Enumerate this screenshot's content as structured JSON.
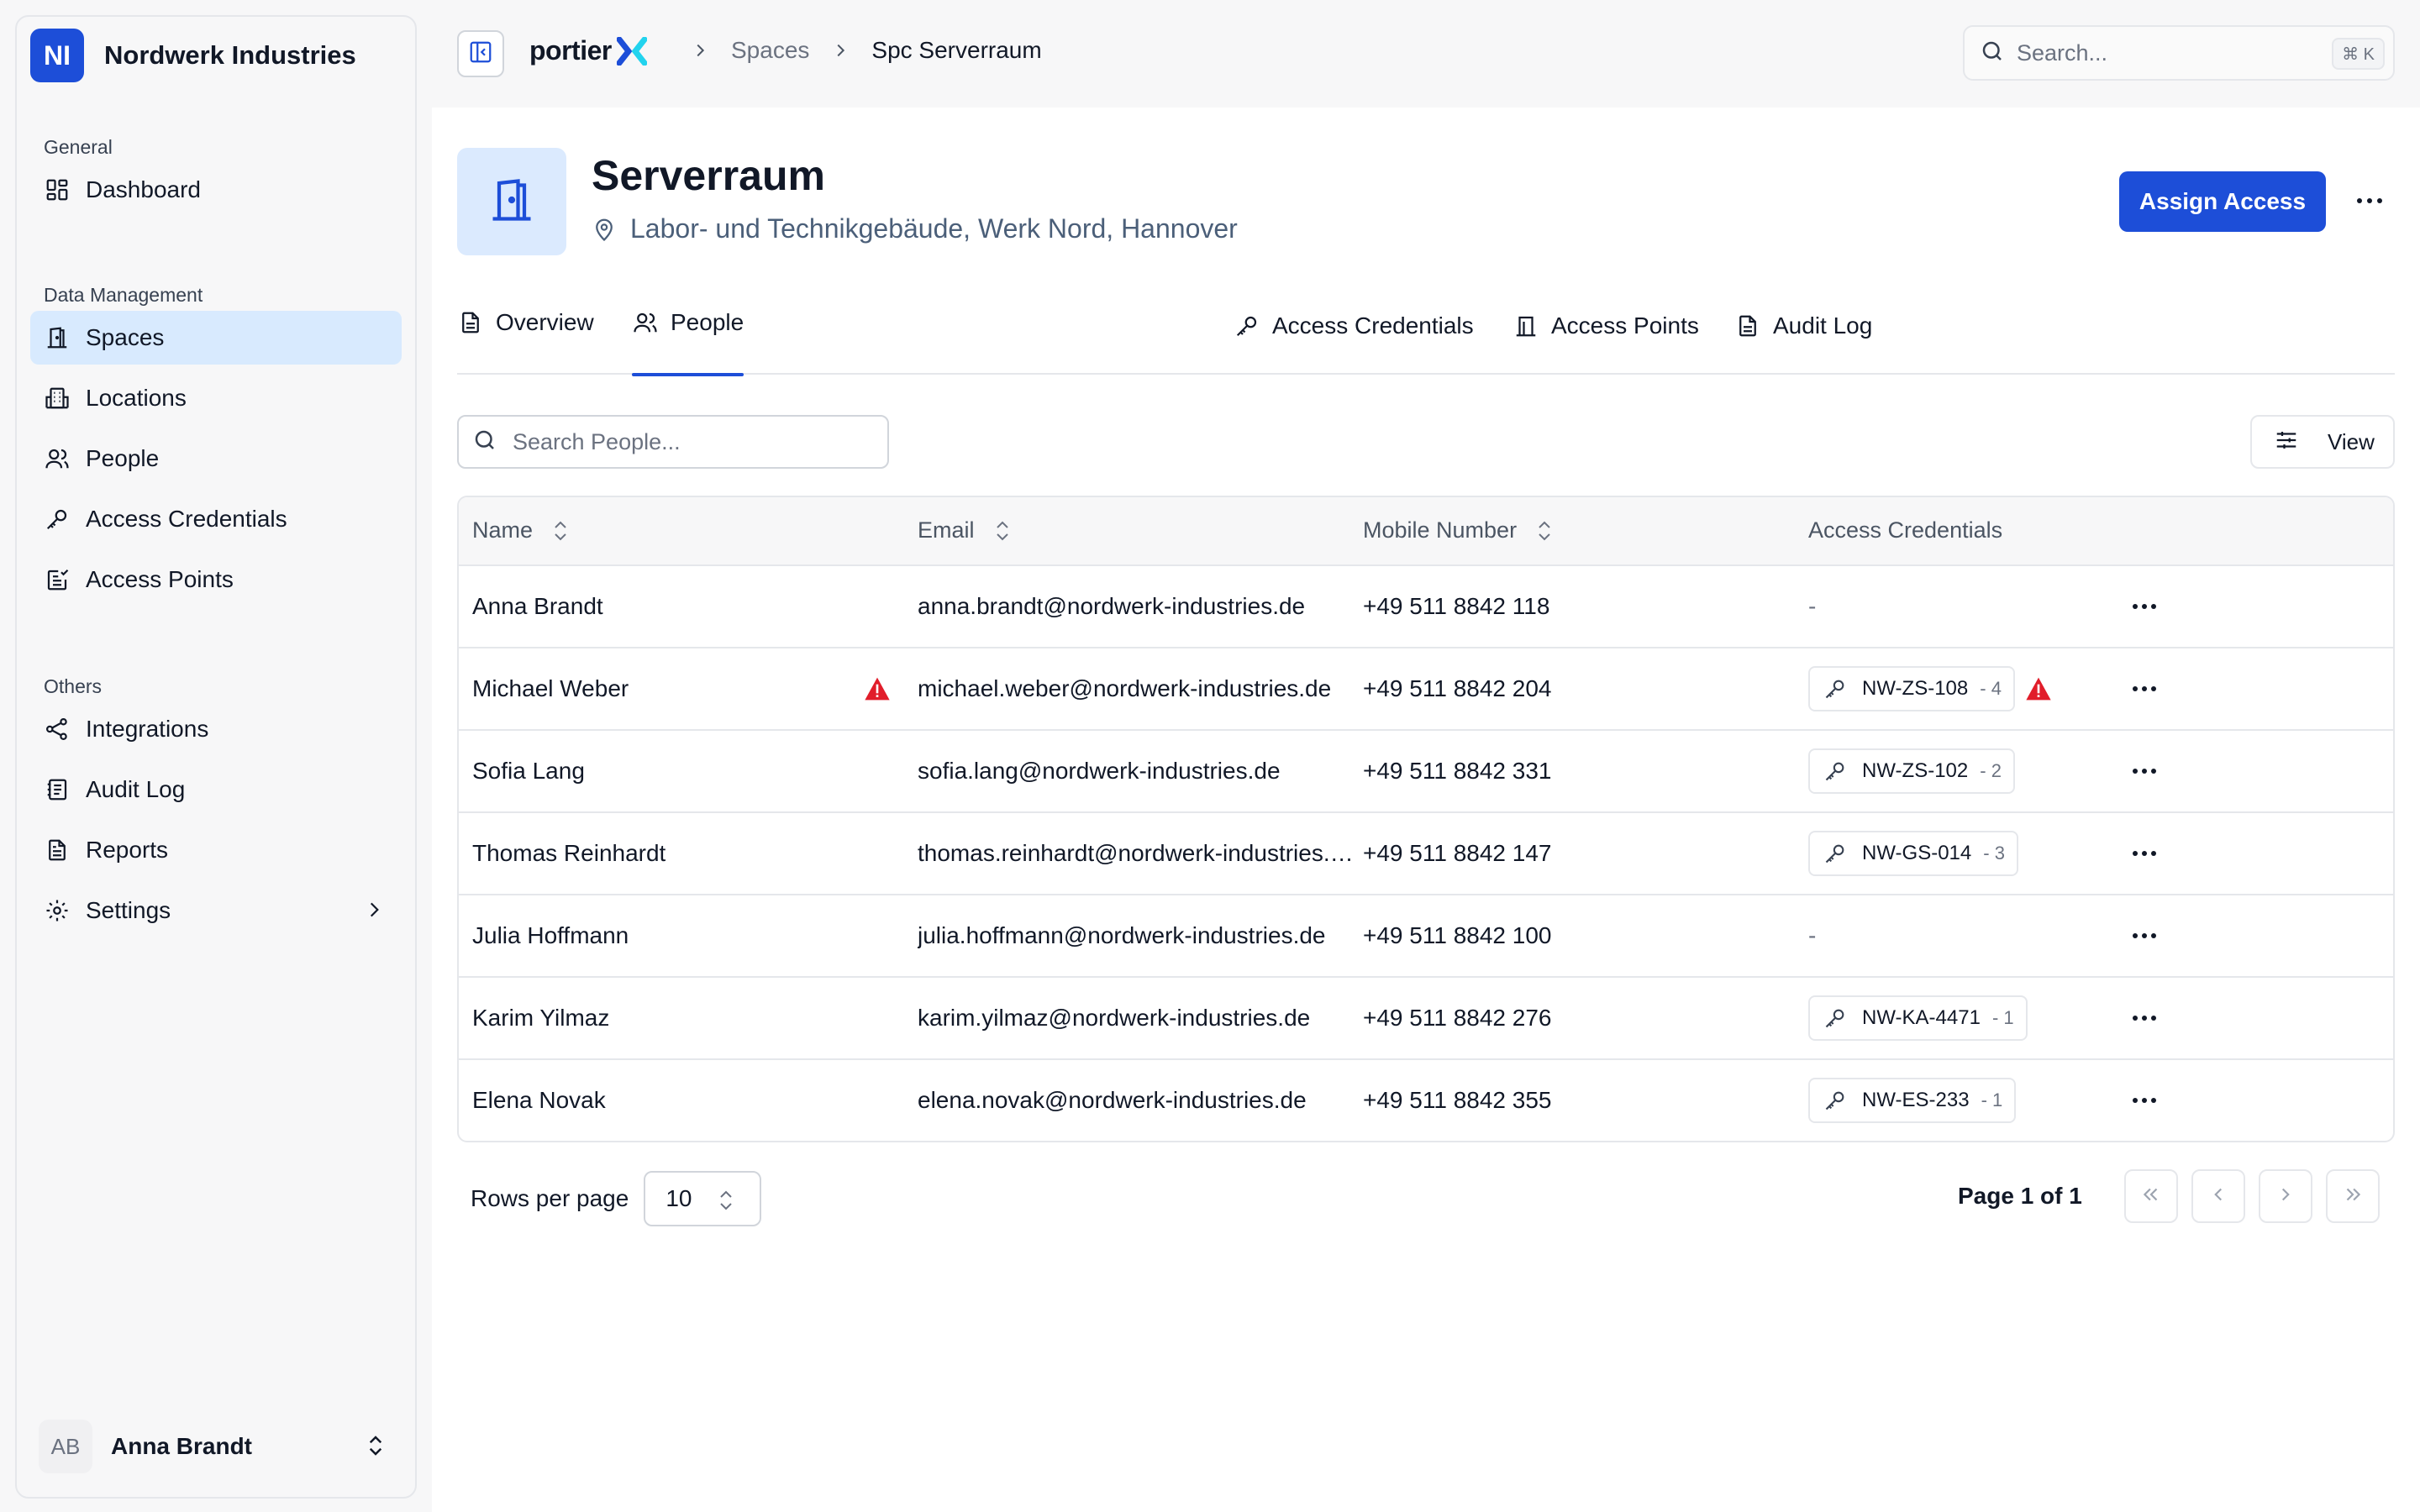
{
  "sidebar": {
    "org": {
      "initials": "NI",
      "name": "Nordwerk Industries"
    },
    "general": {
      "heading": "General",
      "items": [
        {
          "label": "Dashboard",
          "icon": "dashboard-icon"
        }
      ]
    },
    "data_management": {
      "heading": "Data Management",
      "items": [
        {
          "label": "Spaces",
          "icon": "door-icon",
          "active": true
        },
        {
          "label": "Locations",
          "icon": "building-icon"
        },
        {
          "label": "People",
          "icon": "users-icon"
        },
        {
          "label": "Access Credentials",
          "icon": "key-icon"
        },
        {
          "label": "Access Points",
          "icon": "access-point-icon"
        }
      ]
    },
    "others": {
      "heading": "Others",
      "items": [
        {
          "label": "Integrations",
          "icon": "share-icon"
        },
        {
          "label": "Audit Log",
          "icon": "log-icon"
        },
        {
          "label": "Reports",
          "icon": "report-icon"
        },
        {
          "label": "Settings",
          "icon": "gear-icon"
        }
      ]
    },
    "user": {
      "initials": "AB",
      "name": "Anna Brandt"
    }
  },
  "topbar": {
    "brand": "portier",
    "breadcrumb": [
      "Spaces",
      "Spc Serverraum"
    ],
    "search_placeholder": "Search...",
    "shortcut": "⌘ K"
  },
  "space": {
    "title": "Serverraum",
    "location": "Labor- und Technikgebäude, Werk Nord, Hannover",
    "assign_label": "Assign Access"
  },
  "tabs": [
    {
      "label": "Overview",
      "icon": "document-icon"
    },
    {
      "label": "People",
      "icon": "users-icon",
      "active": true
    },
    {
      "label": "Access Credentials",
      "icon": "key-icon"
    },
    {
      "label": "Access Points",
      "icon": "door-frame-icon"
    },
    {
      "label": "Audit Log",
      "icon": "document-icon"
    }
  ],
  "people": {
    "search_placeholder": "Search People...",
    "view_label": "View",
    "columns": [
      "Name",
      "Email",
      "Mobile Number",
      "Access Credentials"
    ],
    "rows": [
      {
        "name": "Anna Brandt",
        "email": "anna.brandt@nordwerk-industries.de",
        "mobile": "+49 511 8842 118",
        "credential": null,
        "count": null,
        "warn": false
      },
      {
        "name": "Michael Weber",
        "email": "michael.weber@nordwerk-industries.de",
        "mobile": "+49 511 8842 204",
        "credential": "NW-ZS-108",
        "count": "- 4",
        "warn": true
      },
      {
        "name": "Sofia Lang",
        "email": "sofia.lang@nordwerk-industries.de",
        "mobile": "+49 511 8842 331",
        "credential": "NW-ZS-102",
        "count": "- 2",
        "warn": false
      },
      {
        "name": "Thomas Reinhardt",
        "email": "thomas.reinhardt@nordwerk-industries.de",
        "mobile": "+49 511 8842 147",
        "credential": "NW-GS-014",
        "count": "- 3",
        "warn": false
      },
      {
        "name": "Julia Hoffmann",
        "email": "julia.hoffmann@nordwerk-industries.de",
        "mobile": "+49 511 8842 100",
        "credential": null,
        "count": null,
        "warn": false
      },
      {
        "name": "Karim Yilmaz",
        "email": "karim.yilmaz@nordwerk-industries.de",
        "mobile": "+49 511 8842 276",
        "credential": "NW-KA-4471",
        "count": "- 1",
        "warn": false
      },
      {
        "name": "Elena Novak",
        "email": "elena.novak@nordwerk-industries.de",
        "mobile": "+49 511 8842 355",
        "credential": "NW-ES-233",
        "count": "- 1",
        "warn": false
      }
    ],
    "empty_value": "-"
  },
  "pagination": {
    "rows_per_page_label": "Rows per page",
    "rows_per_page": "10",
    "page_info": "Page 1 of 1"
  },
  "colors": {
    "accent": "#1d4ed8",
    "active_nav": "#d8eafe",
    "warning": "#e11d2a"
  }
}
